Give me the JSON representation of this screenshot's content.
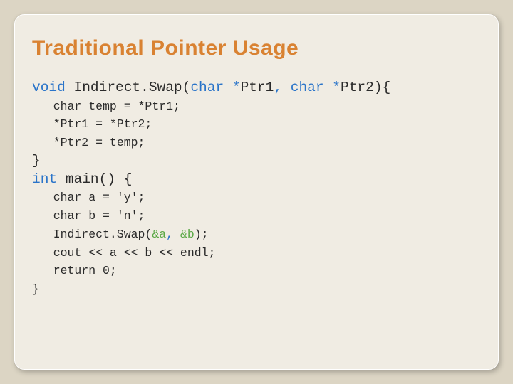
{
  "title": "Traditional Pointer Usage",
  "code": {
    "l1_void": "void",
    "l1_fn": " Indirect.Swap(",
    "l1_p1t": "char ",
    "l1_p1s": "*",
    "l1_p1n": "Ptr1",
    "l1_comma": ", ",
    "l1_p2t": "char ",
    "l1_p2s": "*",
    "l1_p2n": "Ptr2",
    "l1_end": "){",
    "l2": "   char temp = *Ptr1;",
    "l3": "   *Ptr1 = *Ptr2;",
    "l4": "   *Ptr2 = temp;",
    "l5": "}",
    "l6_int": "int",
    "l6_rest": " main() {",
    "l7": "   char a = 'y';",
    "l8": "   char b = 'n';",
    "l9_a": "   Indirect.Swap(",
    "l9_amp1": "&",
    "l9_b": "a",
    "l9_c": ", ",
    "l9_amp2": "&",
    "l9_d": "b",
    "l9_e": ");",
    "l10": "   cout << a << b << endl;",
    "l11": "   return 0;",
    "l12": "}"
  }
}
